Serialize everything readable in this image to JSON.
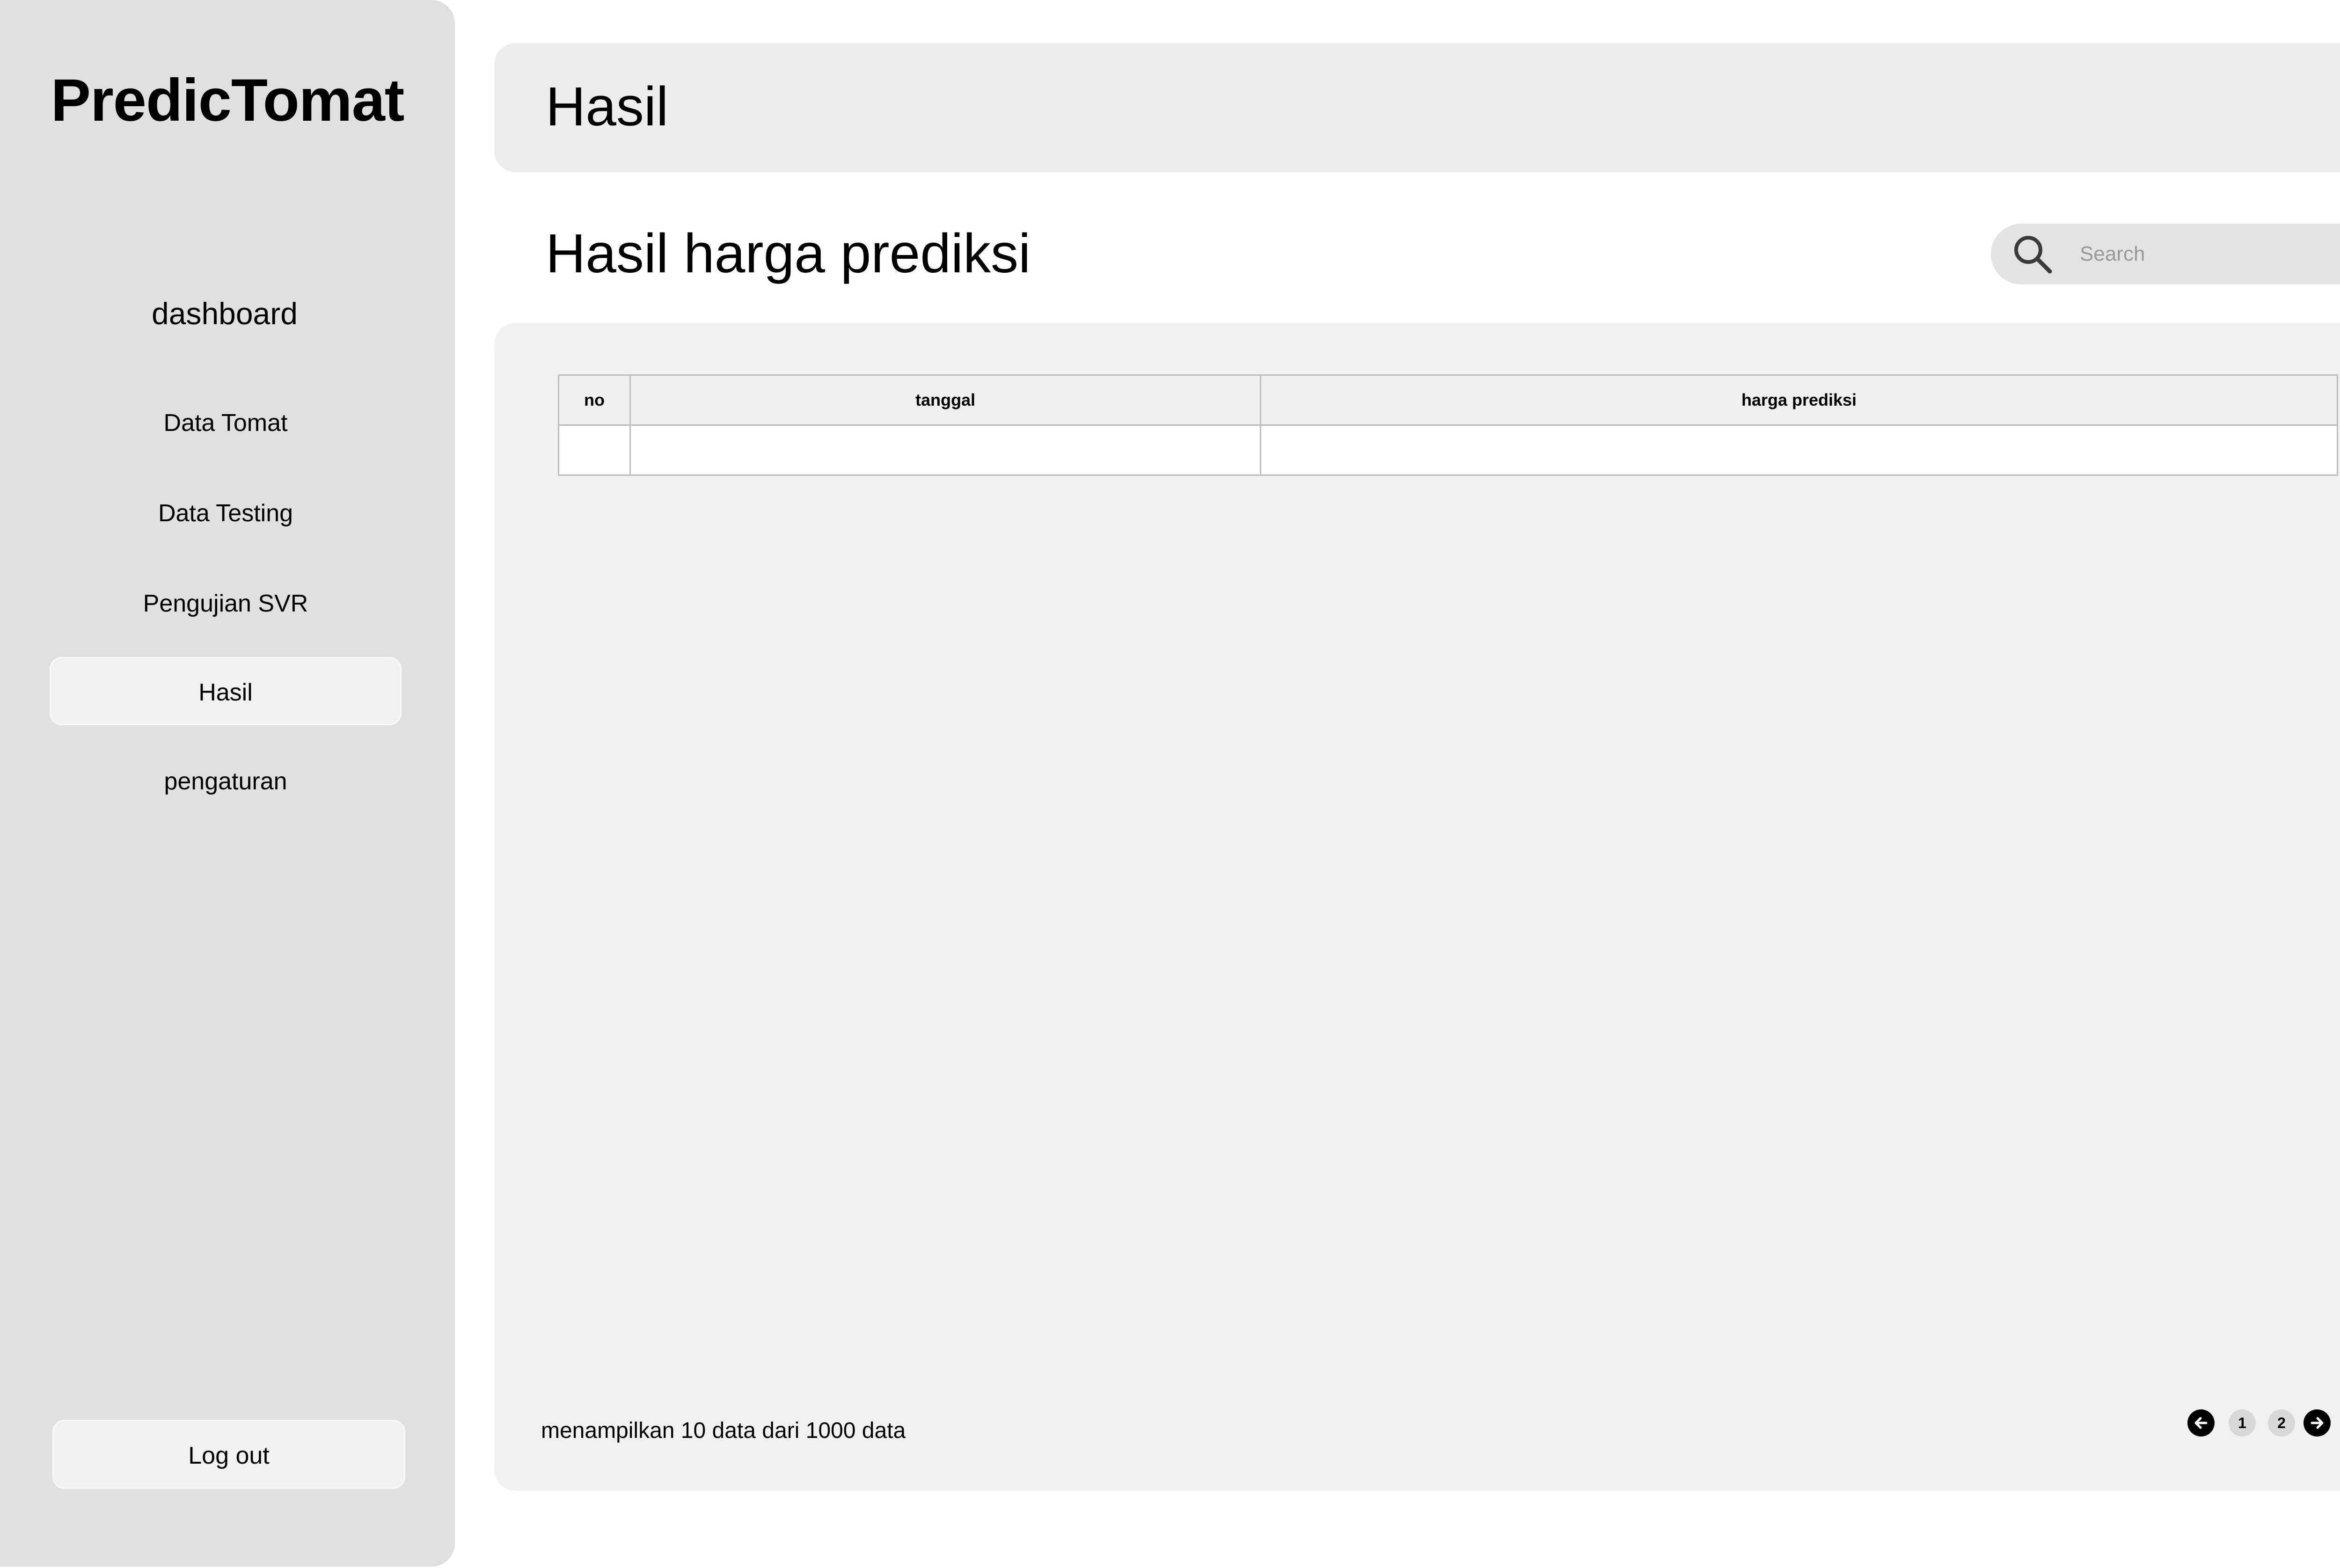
{
  "sidebar": {
    "brand": "PredicTomat",
    "dashboard_label": "dashboard",
    "items": [
      {
        "label": "Data Tomat",
        "active": false
      },
      {
        "label": "Data Testing",
        "active": false
      },
      {
        "label": "Pengujian SVR",
        "active": false
      },
      {
        "label": "Hasil",
        "active": true
      },
      {
        "label": "pengaturan",
        "active": false
      }
    ],
    "logout_label": "Log out"
  },
  "header": {
    "title": "Hasil"
  },
  "main": {
    "section_title": "Hasil harga prediksi",
    "search": {
      "placeholder": "Search",
      "value": "",
      "icon": "search-icon"
    },
    "table": {
      "columns": [
        "no",
        "tanggal",
        "harga prediksi"
      ],
      "rows": [
        [
          "",
          "",
          ""
        ]
      ]
    },
    "footer_info": "menampilkan 10 data dari 1000 data",
    "pagination": {
      "prev_icon": "arrow-left-icon",
      "pages": [
        "1",
        "2"
      ],
      "next_icon": "arrow-right-icon"
    }
  },
  "colors": {
    "sidebar_bg": "#e0e0e0",
    "panel_bg": "#f1f1f1",
    "header_bg": "#ededed",
    "active_item_bg": "#f1f1f1",
    "search_bg": "#e3e3e3"
  }
}
